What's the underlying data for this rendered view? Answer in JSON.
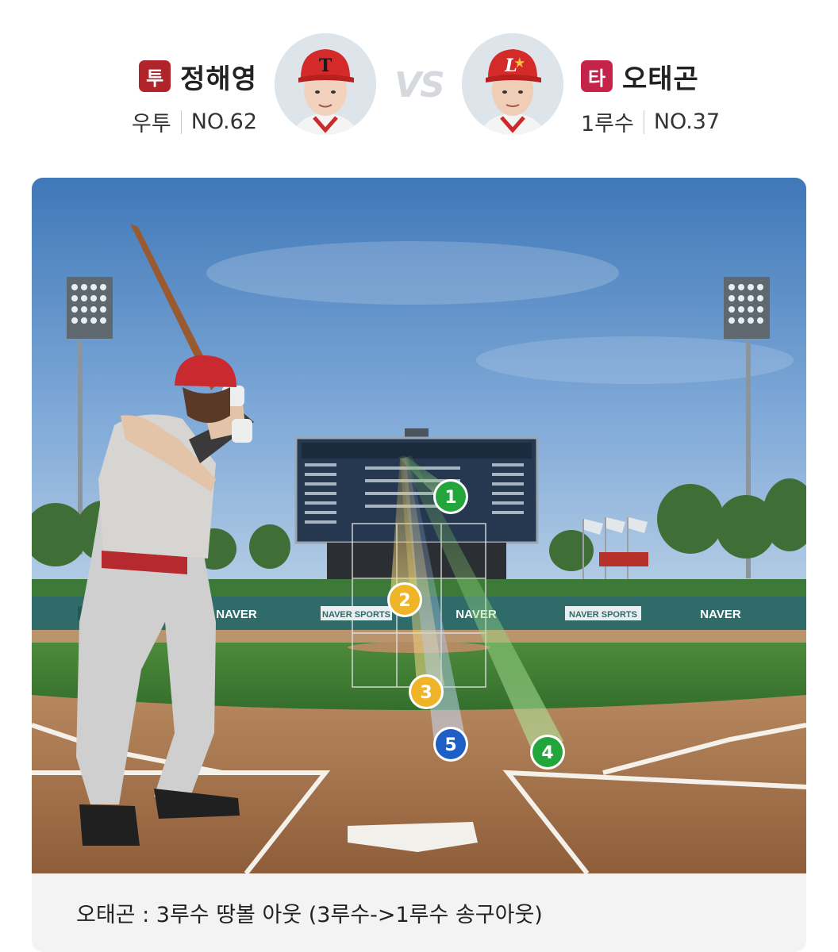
{
  "pitcher": {
    "badge": "투",
    "name": "정해영",
    "throw_hand": "우투",
    "number": "NO.62",
    "badge_color": "#b1242b",
    "cap_color": "#d42a2a",
    "cap_logo": "T"
  },
  "vs_label": "VS",
  "batter": {
    "badge": "타",
    "name": "오태곤",
    "position": "1루수",
    "number": "NO.37",
    "badge_color": "#c6234a",
    "cap_color": "#d42a2a",
    "cap_logo": "L"
  },
  "pitches": [
    {
      "num": "1",
      "color": "#22a53a"
    },
    {
      "num": "2",
      "color": "#f0b429"
    },
    {
      "num": "3",
      "color": "#f0b429"
    },
    {
      "num": "4",
      "color": "#22a53a"
    },
    {
      "num": "5",
      "color": "#1d5fc4"
    }
  ],
  "sponsor_boards": [
    "NAVER",
    "NAVER SPORTS",
    "NAVER",
    "NAVER SPORTS",
    "NAVER",
    "NAVER"
  ],
  "result_text": "오태곤 : 3루수 땅볼 아웃 (3루수->1루수 송구아웃)"
}
